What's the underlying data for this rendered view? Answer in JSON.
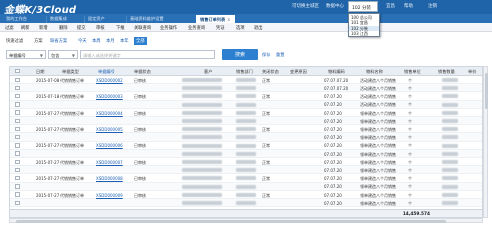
{
  "app": {
    "logo": "金蝶K/3Cloud"
  },
  "topbar": {
    "links": [
      "可切换主城区",
      "数据中心",
      "宜昌",
      "帮助",
      "注销"
    ],
    "org_value": "102 分装"
  },
  "org_dropdown": {
    "items": [
      "100 总公司",
      "101 宜昌",
      "102 分装",
      "103 江西"
    ]
  },
  "tabs": [
    {
      "label": "我的工作台",
      "active": false
    },
    {
      "label": "数据集成",
      "active": false
    },
    {
      "label": "固定资产",
      "active": false
    },
    {
      "label": "基础资料维护设置",
      "active": false
    },
    {
      "label": "销售订单列表",
      "active": true,
      "close": "×"
    }
  ],
  "menu": [
    "过滤",
    "刷新",
    "新增",
    "删除",
    "提交",
    "审核",
    "下推",
    "关联查询",
    "业务操作",
    "业务查询",
    "凭证",
    "选项",
    "退出"
  ],
  "filter_bar": {
    "items": [
      "快速过滤",
      "方案",
      "缺省方案",
      "今天",
      "本周",
      "本月",
      "本年",
      "全部"
    ],
    "active": "全部"
  },
  "search": {
    "field": "单据编号",
    "operator": "包含",
    "placeholder": "请输入或选择关键字",
    "button": "搜索",
    "reset": "重置",
    "save": "保存"
  },
  "columns": [
    "日期",
    "单据类型",
    "单据编号",
    "单据状态",
    "客户",
    "销售部门",
    "关闭状态",
    "变更原因",
    "物料编码",
    "物料名称",
    "销售单位",
    "销售数量",
    "单价"
  ],
  "rows": [
    {
      "date": "2015-07-08",
      "type": "代销销售订单",
      "number": "XSDD000002",
      "status": "已审核",
      "close": "正常",
      "code": "07.07.07.20",
      "name": "活动建造八个月销售",
      "unit": "个"
    },
    {
      "date": "",
      "type": "",
      "number": "",
      "status": "",
      "close": "",
      "code": "07.07.07.20",
      "name": "活动建造八个月销售",
      "unit": "个"
    },
    {
      "date": "2015-07-18",
      "type": "代销销售订单",
      "number": "XSDD000003",
      "status": "已审核",
      "close": "正常",
      "code": "07.07.20",
      "name": "活动建造八个月销售",
      "unit": "个"
    },
    {
      "date": "",
      "type": "",
      "number": "",
      "status": "",
      "close": "",
      "code": "07.07.20",
      "name": "活动建造八个月销售",
      "unit": "个"
    },
    {
      "date": "2015-07-27",
      "type": "代销销售订单",
      "number": "XSDD000004",
      "status": "已审核",
      "close": "正常",
      "code": "07.07.20",
      "name": "领单建造八个月销售",
      "unit": "个"
    },
    {
      "date": "",
      "type": "",
      "number": "",
      "status": "",
      "close": "",
      "code": "07.07.20",
      "name": "领单建造八个月销售",
      "unit": "个"
    },
    {
      "date": "2015-07-27",
      "type": "代销销售订单",
      "number": "XSDD000005",
      "status": "已审核",
      "close": "正常",
      "code": "07.07.20",
      "name": "领单建造八个月销售",
      "unit": "个"
    },
    {
      "date": "",
      "type": "",
      "number": "",
      "status": "",
      "close": "",
      "code": "07.07.20",
      "name": "领单建造八个月销售",
      "unit": "个"
    },
    {
      "date": "2015-07-27",
      "type": "代销销售订单",
      "number": "XSDD000006",
      "status": "已审核",
      "close": "正常",
      "code": "07.07.20",
      "name": "领单建造八个月销售",
      "unit": "个"
    },
    {
      "date": "",
      "type": "",
      "number": "",
      "status": "",
      "close": "",
      "code": "07.07.20",
      "name": "领单建造八个月销售",
      "unit": "个"
    },
    {
      "date": "2015-07-27",
      "type": "代销销售订单",
      "number": "XSDD000007",
      "status": "已审核",
      "close": "正常",
      "code": "07.07.20",
      "name": "领单建造八个月销售",
      "unit": "个"
    },
    {
      "date": "",
      "type": "",
      "number": "",
      "status": "",
      "close": "",
      "code": "07.07.20",
      "name": "领单建造八个月销售",
      "unit": "个"
    },
    {
      "date": "2015-07-27",
      "type": "代销销售订单",
      "number": "XSDD000008",
      "status": "已审核",
      "close": "正常",
      "code": "07.07.20",
      "name": "领单建造八个月销售",
      "unit": "个"
    },
    {
      "date": "",
      "type": "",
      "number": "",
      "status": "",
      "close": "",
      "code": "07.07.20",
      "name": "领单建造八个月销售",
      "unit": "个"
    },
    {
      "date": "2015-07-27",
      "type": "代销销售订单",
      "number": "XSDD000009",
      "status": "已审核",
      "close": "正常",
      "code": "07.07.20",
      "name": "领单建造八个月销售",
      "unit": "个"
    },
    {
      "date": "",
      "type": "",
      "number": "",
      "status": "",
      "close": "",
      "code": "07.07.20",
      "name": "领单建造八个月销售",
      "unit": "个"
    }
  ],
  "footer": {
    "total": "14,459.574"
  }
}
